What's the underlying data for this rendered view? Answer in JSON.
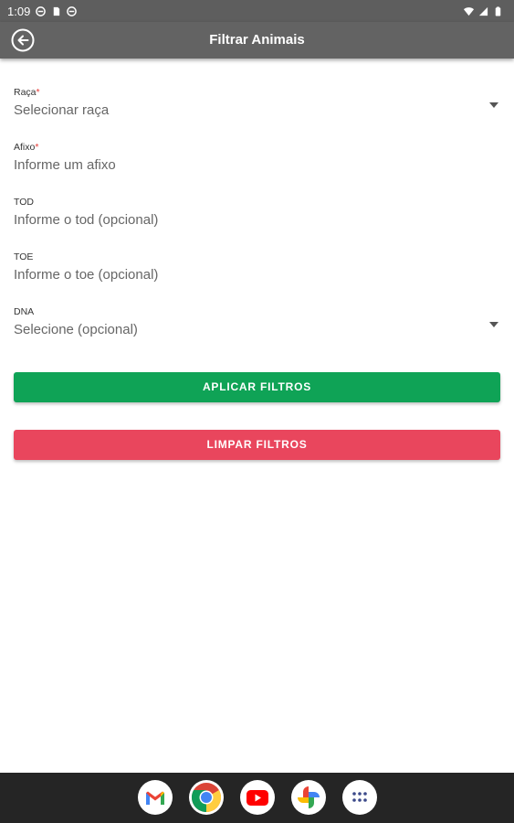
{
  "status_bar": {
    "time": "1:09"
  },
  "app_bar": {
    "title": "Filtrar Animais"
  },
  "form": {
    "raca": {
      "label": "Raça",
      "required_mark": "*",
      "placeholder": "Selecionar raça"
    },
    "afixo": {
      "label": "Afixo",
      "required_mark": "*",
      "placeholder": "Informe um afixo"
    },
    "tod": {
      "label": "TOD",
      "placeholder": "Informe o tod (opcional)"
    },
    "toe": {
      "label": "TOE",
      "placeholder": "Informe o toe (opcional)"
    },
    "dna": {
      "label": "DNA",
      "placeholder": "Selecione (opcional)"
    }
  },
  "buttons": {
    "apply": "APLICAR FILTROS",
    "clear": "LIMPAR FILTROS"
  },
  "dock": [
    "gmail-icon",
    "chrome-icon",
    "youtube-icon",
    "photos-icon",
    "app-drawer-icon"
  ],
  "colors": {
    "apply": "#0fa356",
    "clear": "#e9465d",
    "appbar": "#636363",
    "required": "#e53935"
  }
}
